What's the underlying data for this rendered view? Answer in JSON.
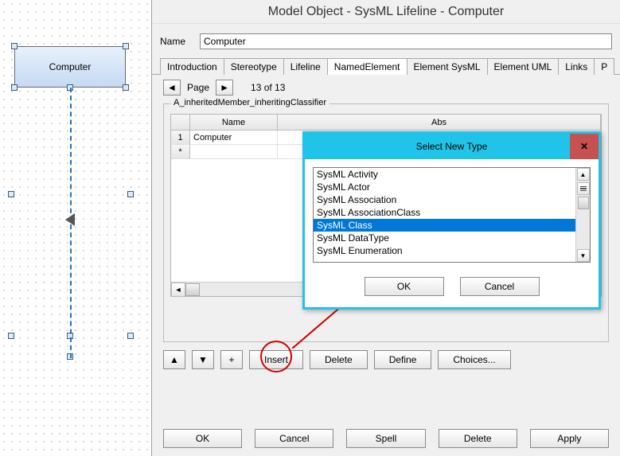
{
  "canvas": {
    "lifeline_label": "Computer"
  },
  "dialog": {
    "title": "Model Object - SysML Lifeline - Computer",
    "name_label": "Name",
    "name_value": "Computer",
    "tabs": [
      "Introduction",
      "Stereotype",
      "Lifeline",
      "NamedElement",
      "Element SysML",
      "Element UML",
      "Links",
      "P"
    ],
    "active_tab": 3,
    "pager": {
      "label": "Page",
      "text": "13 of 13"
    },
    "fieldset_legend": "A_inheritedMember_inheritingClassifier",
    "table": {
      "headers": [
        "",
        "Name",
        "Abs"
      ],
      "rows": [
        {
          "num": "1",
          "name": "Computer",
          "abs": ""
        },
        {
          "num": "*",
          "name": "",
          "abs": ""
        }
      ]
    },
    "row_buttons": {
      "plus": "+",
      "insert": "Insert",
      "delete": "Delete",
      "define": "Define",
      "choices": "Choices..."
    },
    "bottom_buttons": {
      "ok": "OK",
      "cancel": "Cancel",
      "spell": "Spell",
      "delete": "Delete",
      "apply": "Apply"
    }
  },
  "modal": {
    "title": "Select New Type",
    "items": [
      "SysML Activity",
      "SysML Actor",
      "SysML Association",
      "SysML AssociationClass",
      "SysML Class",
      "SysML DataType",
      "SysML Enumeration"
    ],
    "selected_index": 4,
    "ok": "OK",
    "cancel": "Cancel"
  }
}
